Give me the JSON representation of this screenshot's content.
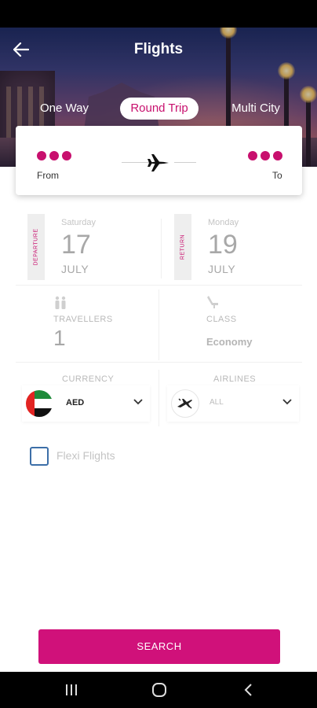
{
  "header": {
    "title": "Flights",
    "back_icon": "arrow-left-icon"
  },
  "trip_tabs": [
    {
      "label": "One Way",
      "active": false
    },
    {
      "label": "Round Trip",
      "active": true
    },
    {
      "label": "Multi City",
      "active": false
    }
  ],
  "route": {
    "from_label": "From",
    "to_label": "To",
    "plane_icon": "airplane-icon"
  },
  "dates": {
    "departure": {
      "tag": "DEPARTURE",
      "day": "Saturday",
      "date": "17",
      "month": "JULY"
    },
    "return": {
      "tag": "RETURN",
      "day": "Monday",
      "date": "19",
      "month": "JULY"
    }
  },
  "travellers": {
    "label": "TRAVELLERS",
    "value": "1",
    "icon": "people-icon"
  },
  "class": {
    "label": "CLASS",
    "value": "Economy",
    "icon": "seat-icon"
  },
  "currency": {
    "label": "CURRENCY",
    "value": "AED",
    "icon": "uae-flag-icon"
  },
  "airlines": {
    "label": "AIRLINES",
    "value": "ALL",
    "icon": "airlines-icon"
  },
  "flexi": {
    "label": "Flexi Flights",
    "checked": false
  },
  "search_button": {
    "label": "SEARCH"
  },
  "colors": {
    "accent": "#c8106e",
    "button": "#d0117a",
    "checkbox": "#3d6fa8"
  }
}
